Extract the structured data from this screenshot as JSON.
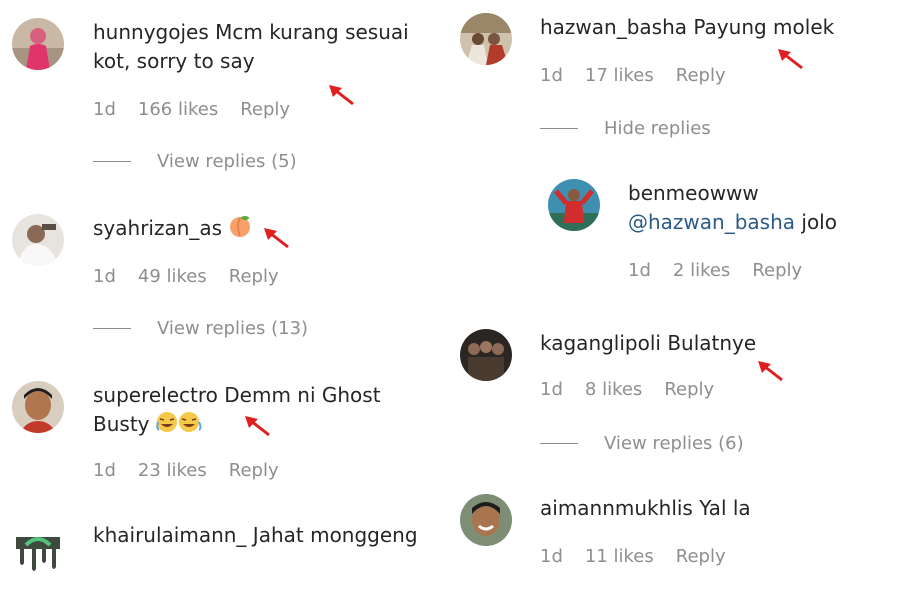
{
  "colors": {
    "username": "#262626",
    "meta": "#8e8e8e",
    "mention": "#2b5b86",
    "arrow": "#e02020"
  },
  "left": [
    {
      "username": "hunnygojes",
      "text": "Mcm kurang sesuai kot, sorry to say",
      "age": "1d",
      "likes": "166 likes",
      "reply": "Reply",
      "thread": "View replies (5)",
      "avatar": "pink-figure-avatar"
    },
    {
      "username": "syahrizan_as",
      "text": "",
      "emoji": "peach-emoji",
      "age": "1d",
      "likes": "49 likes",
      "reply": "Reply",
      "thread": "View replies (13)",
      "avatar": "person-in-white-avatar"
    },
    {
      "username": "superelectro",
      "text": "Demm ni Ghost Busty",
      "emoji": "crying-laughing-emoji",
      "age": "1d",
      "likes": "23 likes",
      "reply": "Reply",
      "avatar": "face-portrait-avatar"
    },
    {
      "username": "khairulaimann_",
      "text": "Jahat monggeng",
      "avatar": "dripping-logo-avatar"
    }
  ],
  "right": [
    {
      "username": "hazwan_basha",
      "text": "Payung molek",
      "age": "1d",
      "likes": "17 likes",
      "reply": "Reply",
      "thread": "Hide replies",
      "avatar": "group-photo-avatar"
    },
    {
      "username": "benmeowww",
      "mention": "@hazwan_basha",
      "text": "jolo",
      "age": "1d",
      "likes": "2 likes",
      "reply": "Reply",
      "avatar": "red-jersey-avatar"
    },
    {
      "username": "kaganglipoli",
      "text": "Bulatnye",
      "age": "1d",
      "likes": "8 likes",
      "reply": "Reply",
      "thread": "View replies (6)",
      "avatar": "dark-group-avatar"
    },
    {
      "username": "aimannmukhlis",
      "text": "Yal la",
      "age": "1d",
      "likes": "11 likes",
      "reply": "Reply",
      "avatar": "smiling-man-avatar"
    }
  ]
}
